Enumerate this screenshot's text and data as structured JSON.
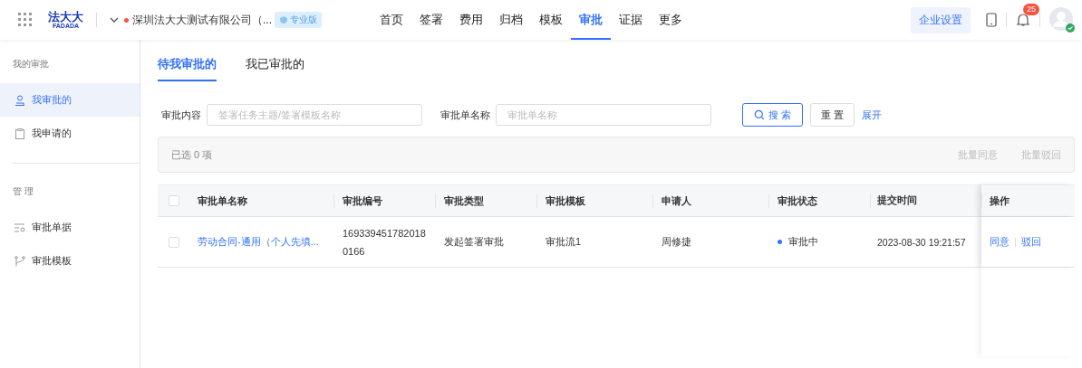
{
  "header": {
    "logo_cn": "法大大",
    "logo_en": "FADADA",
    "company": "深圳法大大测试有限公司（...",
    "edition_badge": "专业版",
    "nav": [
      {
        "label": "首页",
        "selected": false
      },
      {
        "label": "签署",
        "selected": false
      },
      {
        "label": "费用",
        "selected": false
      },
      {
        "label": "归档",
        "selected": false
      },
      {
        "label": "模板",
        "selected": false
      },
      {
        "label": "审批",
        "selected": true
      },
      {
        "label": "证据",
        "selected": false
      },
      {
        "label": "更多",
        "selected": false
      }
    ],
    "settings_button": "企业设置",
    "notification_count": "25"
  },
  "sidebar": {
    "sections": [
      {
        "title": "我的审批",
        "items": [
          {
            "label": "我审批的",
            "kind": "user",
            "selected": true
          },
          {
            "label": "我申请的",
            "kind": "clipboard",
            "selected": false
          }
        ]
      },
      {
        "title": "管 理",
        "items": [
          {
            "label": "审批单据",
            "kind": "list",
            "selected": false
          },
          {
            "label": "审批模板",
            "kind": "branch",
            "selected": false
          }
        ]
      }
    ]
  },
  "tabs": [
    {
      "label": "待我审批的",
      "selected": true
    },
    {
      "label": "我已审批的",
      "selected": false
    }
  ],
  "filters": [
    {
      "label": "审批内容",
      "placeholder": "签署任务主题/签署模板名称"
    },
    {
      "label": "审批单名称",
      "placeholder": "审批单名称"
    }
  ],
  "search_button": "搜 索",
  "reset_button": "重 置",
  "expand_link": "展开",
  "selection_bar": {
    "text": "已选 0 项",
    "actions": [
      "批量同意",
      "批量驳回"
    ]
  },
  "table": {
    "all_checked": false,
    "columns": [
      "审批单名称",
      "审批编号",
      "审批类型",
      "审批模板",
      "申请人",
      "审批状态",
      "提交时间",
      "操作"
    ],
    "rows": [
      {
        "checked": false,
        "name": "劳动合同-通用（个人先填...",
        "number": "1693394517820180166",
        "type": "发起签署审批",
        "template": "审批流1",
        "applicant": "周修捷",
        "status": "审批中",
        "color": "#3370ff",
        "time": "2023-08-30 19:21:57",
        "actions": [
          "同意",
          "驳回"
        ]
      }
    ]
  }
}
